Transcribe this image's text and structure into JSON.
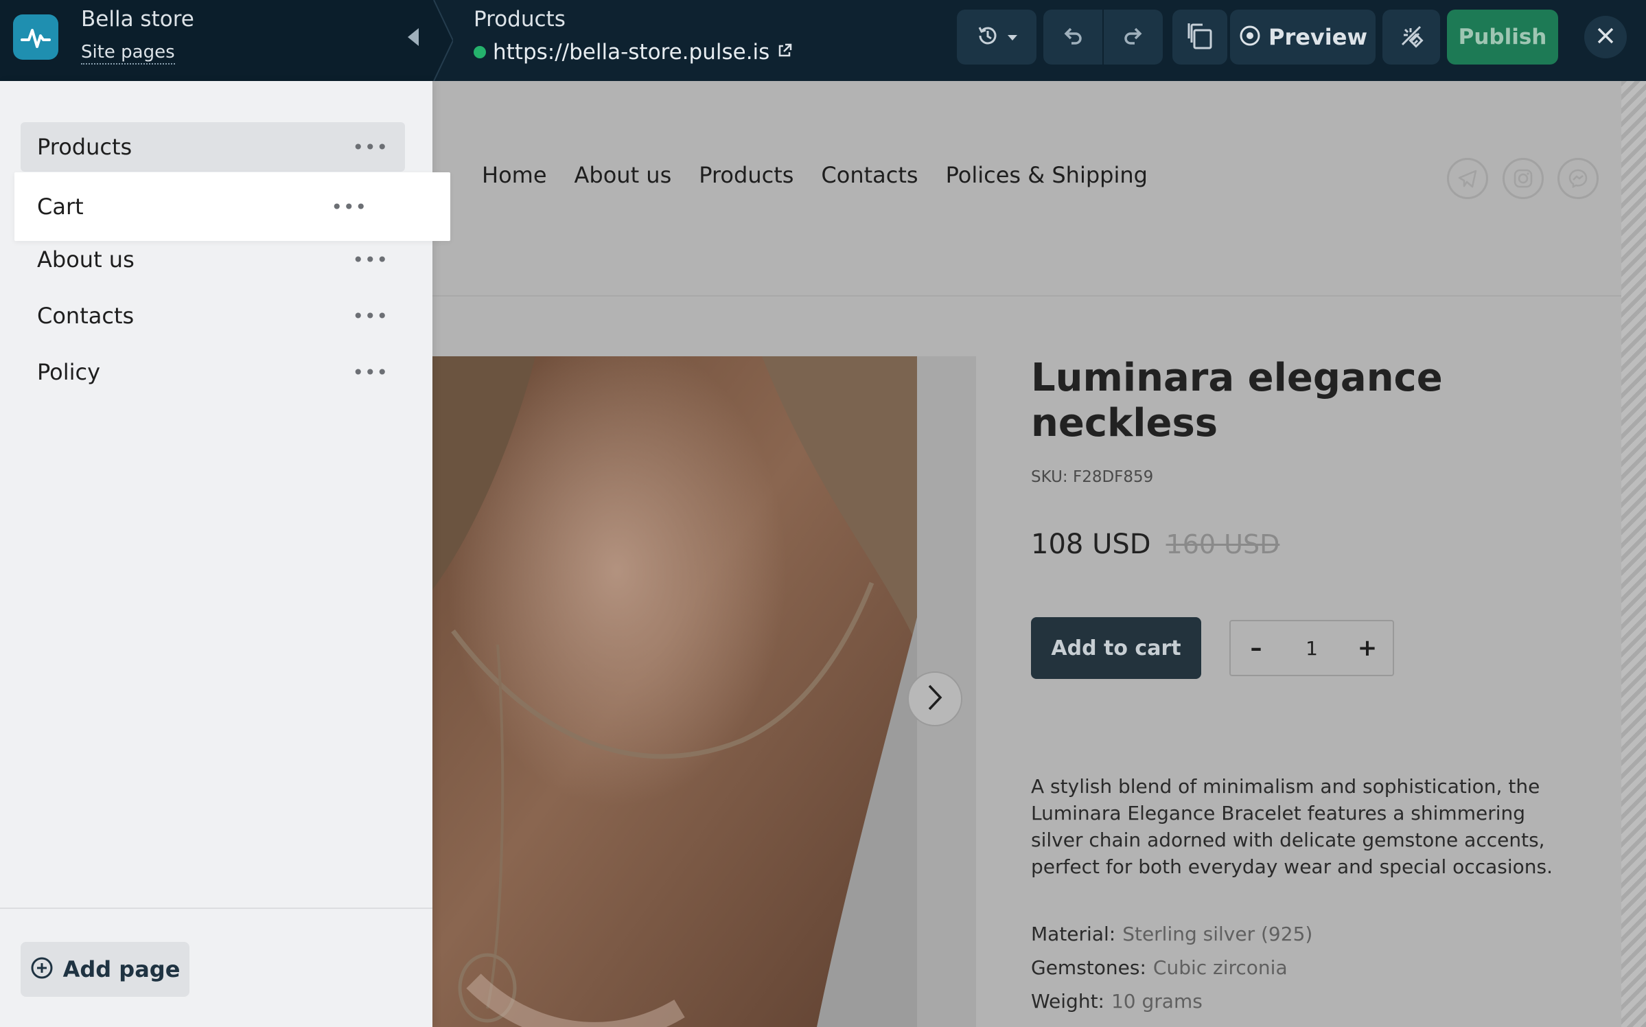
{
  "app": {
    "store_name": "Bella store",
    "site_pages_link": "Site pages",
    "current_page": "Products",
    "url": "https://bella-store.pulse.is",
    "preview_label": "Preview",
    "publish_label": "Publish"
  },
  "sidebar": {
    "pages": [
      {
        "label": "Products"
      },
      {
        "label": "Cart"
      },
      {
        "label": "About us"
      },
      {
        "label": "Contacts"
      },
      {
        "label": "Policy"
      }
    ],
    "more_glyph": "•••",
    "add_page_label": "Add page"
  },
  "site": {
    "nav": [
      "Home",
      "About us",
      "Products",
      "Contacts",
      "Polices & Shipping"
    ],
    "social_icons": [
      "telegram-icon",
      "instagram-icon",
      "messenger-icon"
    ]
  },
  "product": {
    "title": "Luminara elegance neckless",
    "sku": "SKU: F28DF859",
    "price": "108 USD",
    "old_price": "160 USD",
    "add_to_cart_label": "Add to cart",
    "quantity": "1",
    "qty_minus": "–",
    "qty_plus": "+",
    "description": "A stylish blend of minimalism and sophistication, the Luminara Elegance Bracelet features a shimmering silver chain adorned with delicate gemstone accents, perfect for both everyday wear and special occasions.",
    "specs": [
      {
        "key": "Material:",
        "value": "Sterling silver (925)"
      },
      {
        "key": "Gemstones:",
        "value": "Cubic zirconia"
      },
      {
        "key": "Weight:",
        "value": "10 grams"
      }
    ]
  },
  "colors": {
    "topbar": "#0e2230",
    "publish": "#1d7a55",
    "status_online": "#25b26c"
  }
}
